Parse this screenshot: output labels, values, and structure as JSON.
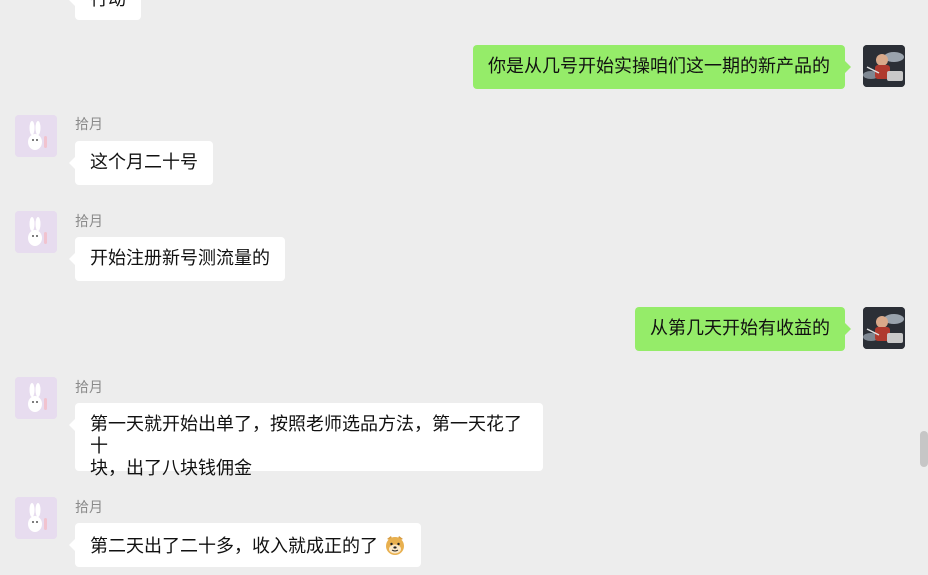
{
  "messages": [
    {
      "text": "行动"
    },
    {
      "text": "你是从几号开始实操咱们这一期的新产品的"
    },
    {
      "sender": "拾月",
      "text": "这个月二十号"
    },
    {
      "sender": "拾月",
      "text": "开始注册新号测流量的"
    },
    {
      "text": "从第几天开始有收益的"
    },
    {
      "sender": "拾月",
      "line1": "第一天就开始出单了，按照老师选品方法，第一天花了十",
      "line2": "块，出了八块钱佣金"
    },
    {
      "sender": "拾月",
      "text": "第二天出了二十多，收入就成正的了",
      "emoji": "doge-emoji"
    }
  ],
  "colors": {
    "background": "#ededed",
    "self_bubble": "#95ec69",
    "other_bubble": "#ffffff"
  }
}
